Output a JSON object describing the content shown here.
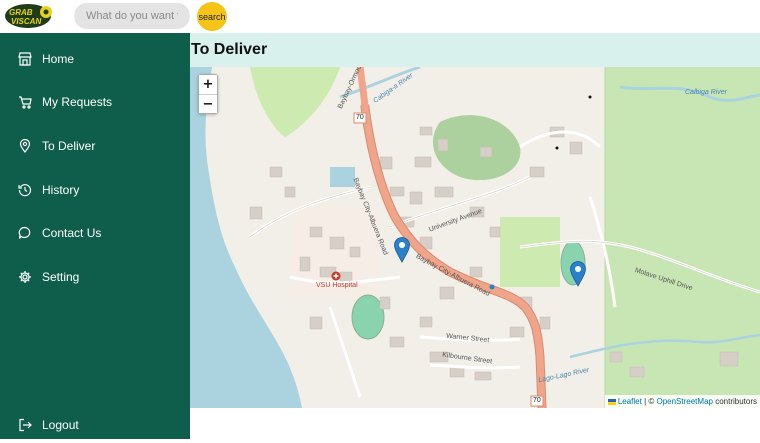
{
  "header": {
    "logo_text_1": "GRAB",
    "logo_text_2": "VISCAN",
    "search_placeholder": "What do you want to",
    "search_button": "search"
  },
  "sidebar": {
    "items": [
      {
        "label": "Home",
        "icon": "store-icon"
      },
      {
        "label": "My Requests",
        "icon": "cart-icon"
      },
      {
        "label": "To Deliver",
        "icon": "location-pin-icon"
      },
      {
        "label": "History",
        "icon": "history-icon"
      },
      {
        "label": "Contact Us",
        "icon": "chat-icon"
      },
      {
        "label": "Setting",
        "icon": "gear-icon"
      }
    ],
    "logout": {
      "label": "Logout",
      "icon": "logout-icon"
    }
  },
  "main": {
    "title": "To Deliver"
  },
  "map": {
    "zoom_in": "+",
    "zoom_out": "−",
    "labels": {
      "river_1": "Cabiga-a River",
      "river_2": "Calbiga River",
      "road_1": "Baybay City-Albuera Road",
      "road_2": "Baybay City-Albuera Road",
      "road_3": "Baybay-Ormoc Road",
      "avenue": "University Avenue",
      "hospital": "VSU Hospital",
      "warner": "Warner Street",
      "kilbourne": "Kilbourne Street",
      "lago": "Lago-Lago River",
      "molave": "Molave Uphill Drive",
      "route_1": "70",
      "route_2": "70"
    },
    "attribution": {
      "leaflet": "Leaflet",
      "separator": " | © ",
      "osm": "OpenStreetMap",
      "contributors": " contributors"
    },
    "colors": {
      "land": "#f2efe9",
      "water": "#aad3df",
      "park": "#c8e6b4",
      "road_primary": "#f0a58a",
      "building": "#d6cfc7",
      "marker": "#2a81cb"
    }
  },
  "theme": {
    "sidebar_bg": "#0e5e4b",
    "title_bg": "#d9f1ec",
    "accent": "#f6c317"
  }
}
